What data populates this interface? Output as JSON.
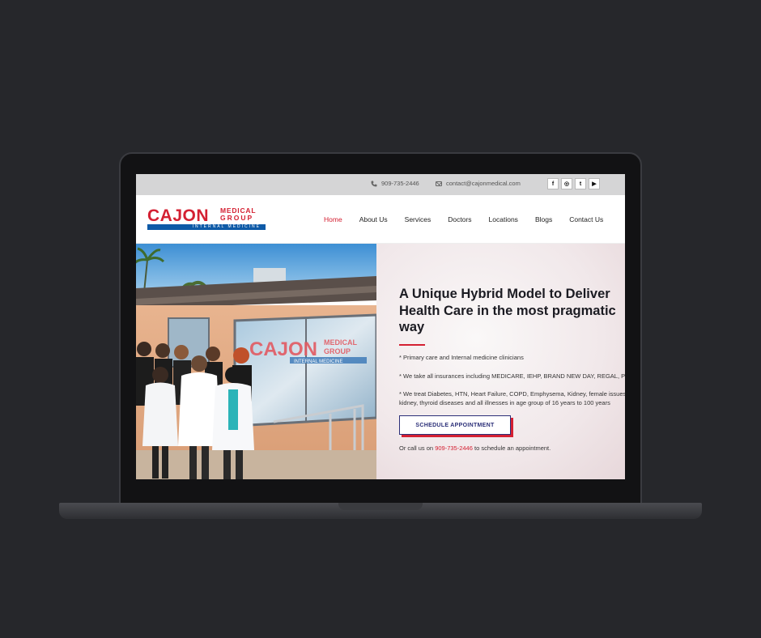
{
  "topbar": {
    "phone": "909-735-2446",
    "email": "contact@cajonmedical.com",
    "socials": [
      {
        "icon": "facebook-icon",
        "glyph": "f"
      },
      {
        "icon": "instagram-icon",
        "glyph": "◎"
      },
      {
        "icon": "twitter-icon",
        "glyph": "t"
      },
      {
        "icon": "youtube-icon",
        "glyph": "▶"
      }
    ]
  },
  "logo": {
    "name": "CAJON",
    "medical": "MEDICAL",
    "group": "GROUP",
    "tagline": "INTERNAL MEDICINE"
  },
  "nav": {
    "items": [
      "Home",
      "About Us",
      "Services",
      "Doctors",
      "Locations",
      "Blogs",
      "Contact Us"
    ],
    "active": "Home"
  },
  "hero": {
    "headline": "A Unique Hybrid Model to Deliver Health Care in the most pragmatic way",
    "bullets": [
      "* Primary care and Internal medicine clinicians",
      "* We take all insurances including MEDICARE, IEHP, BRAND NEW DAY, REGAL, PRIME, and more",
      "* We treat Diabetes, HTN, Heart Failure, COPD, Emphysema, Kidney, female issues, ",
      "kidney, thyroid diseases and all illnesses in age group of 16 years to 100 years"
    ],
    "cta_label": "SCHEDULE APPOINTMENT",
    "call_prefix": "Or call us on ",
    "call_phone": "909-735-2446",
    "call_suffix": " to schedule an appointment.",
    "photo_sign": "CAJON MEDICAL GROUP",
    "photo_sign_sub": "INTERNAL MEDICINE"
  },
  "colors": {
    "brand_red": "#d42032",
    "brand_blue": "#0e5aa7",
    "cta_navy": "#2b2f78"
  }
}
